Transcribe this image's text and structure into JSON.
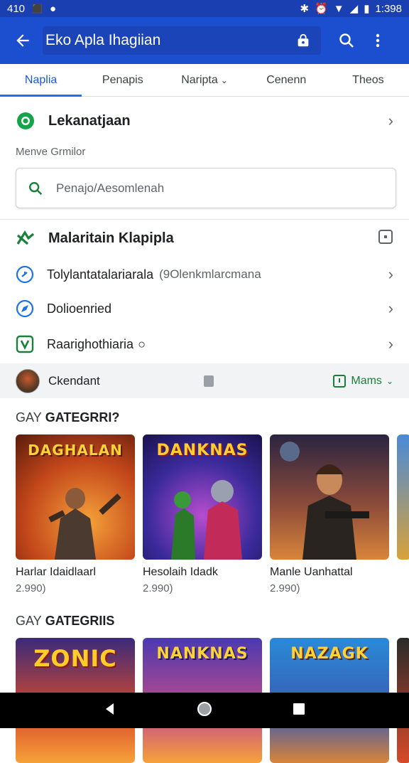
{
  "status_bar": {
    "time": "410",
    "clock": "1:398"
  },
  "app_bar": {
    "search_query": "Eko Apla Ihagiian"
  },
  "tabs": [
    {
      "label": "Naplia"
    },
    {
      "label": "Penapis"
    },
    {
      "label": "Naripta"
    },
    {
      "label": "Cenenn"
    },
    {
      "label": "Theos"
    }
  ],
  "header_row": {
    "label": "Lekanatjaan"
  },
  "section": {
    "label": "Menve Grmilor"
  },
  "search_field": {
    "placeholder": "Penajo/Aesomlenah"
  },
  "list": {
    "title": "Malaritain Klapipla",
    "items": [
      {
        "label": "Tolylantatalariarala",
        "secondary": "(9Olenkmlarcmana"
      },
      {
        "label": "Dolioenried",
        "secondary": ""
      },
      {
        "label": "Raarighothiaria",
        "secondary": ""
      }
    ]
  },
  "user_bar": {
    "name": "Ckendant",
    "menu_label": "Mams"
  },
  "categories": [
    {
      "prefix": "GAY",
      "title": "GATEGRRI?",
      "games": [
        {
          "name": "Harlar Idaidlaarl",
          "price": "2.990)",
          "logo": "DAGHALAN"
        },
        {
          "name": "Hesolaih Idadk",
          "price": "2.990)",
          "logo": "DANKNAS"
        },
        {
          "name": "Manle Uanhattal",
          "price": "2.990)",
          "logo": ""
        }
      ]
    },
    {
      "prefix": "GAY",
      "title": "GATEGRIIS",
      "games": [
        {
          "name": "",
          "price": "",
          "logo": "ZONIC"
        },
        {
          "name": "",
          "price": "",
          "logo": "NANKNAS"
        },
        {
          "name": "",
          "price": "",
          "logo": "NAZAGK"
        }
      ]
    }
  ],
  "colors": {
    "app_bar": "#1c4fd0",
    "status_bar": "#1a3fb0",
    "accent": "#1a73e8",
    "green": "#188038"
  }
}
